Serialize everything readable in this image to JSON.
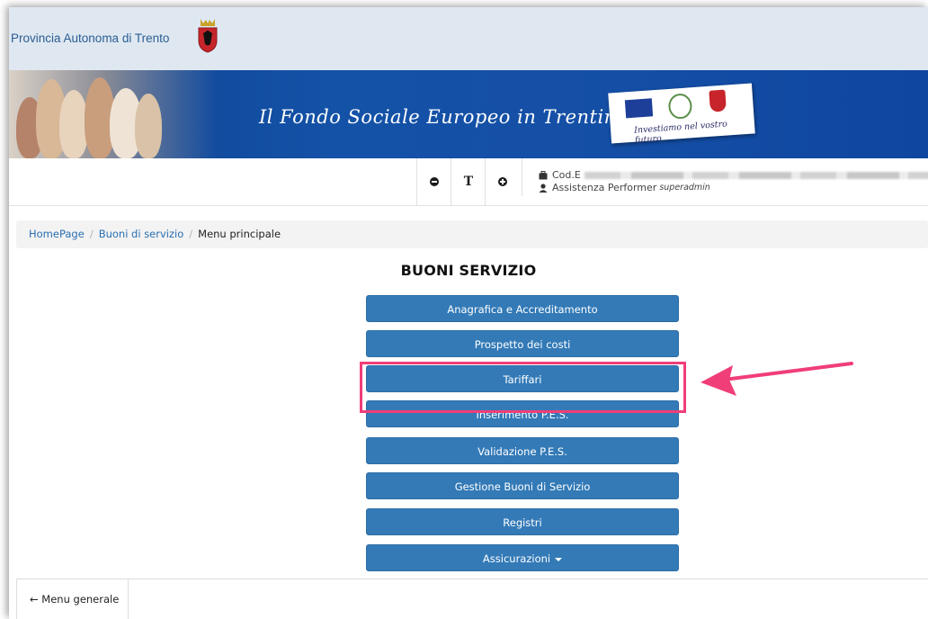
{
  "header": {
    "org_title": "Provincia Autonoma di Trento",
    "banner_text": "Il Fondo Sociale Europeo in Trentino",
    "logos_caption": "Investiamo nel vostro futuro"
  },
  "toolbar": {
    "decrease_font": "decrease-font",
    "font_size": "T",
    "increase_font": "increase-font",
    "user": {
      "code_prefix": "Cod.E",
      "name": "Assistenza Performer",
      "role": "superadmin"
    }
  },
  "breadcrumb": {
    "items": [
      "HomePage",
      "Buoni di servizio"
    ],
    "active": "Menu principale"
  },
  "page": {
    "title": "BUONI SERVIZIO",
    "menu": [
      "Anagrafica e Accreditamento",
      "Prospetto dei costi",
      "Tariffari",
      "Inserimento P.E.S.",
      "Validazione P.E.S.",
      "Gestione Buoni di Servizio",
      "Registri",
      "Assicurazioni"
    ]
  },
  "footer": {
    "back_label": "← Menu generale"
  },
  "colors": {
    "primary_button": "#337ab7",
    "highlight": "#f03e78",
    "banner": "#1452a7",
    "link": "#2a6fb0"
  }
}
